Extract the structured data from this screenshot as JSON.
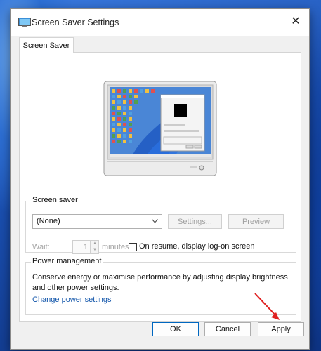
{
  "window": {
    "title": "Screen Saver Settings",
    "close_symbol": "✕"
  },
  "tabs": [
    {
      "label": "Screen Saver"
    }
  ],
  "screen_saver": {
    "group_title": "Screen saver",
    "selected": "(None)",
    "settings_label": "Settings...",
    "preview_label": "Preview",
    "wait_label": "Wait:",
    "wait_value": "1",
    "minutes_label": "minutes",
    "resume_checked": false,
    "resume_label": "On resume, display log-on screen"
  },
  "power": {
    "group_title": "Power management",
    "description": "Conserve energy or maximise performance by adjusting display brightness and other power settings.",
    "link_label": "Change power settings"
  },
  "footer": {
    "ok_label": "OK",
    "cancel_label": "Cancel",
    "apply_label": "Apply"
  },
  "colors": {
    "link": "#1155aa",
    "annotation_arrow": "#e02020",
    "primary_border": "#0067c0"
  }
}
